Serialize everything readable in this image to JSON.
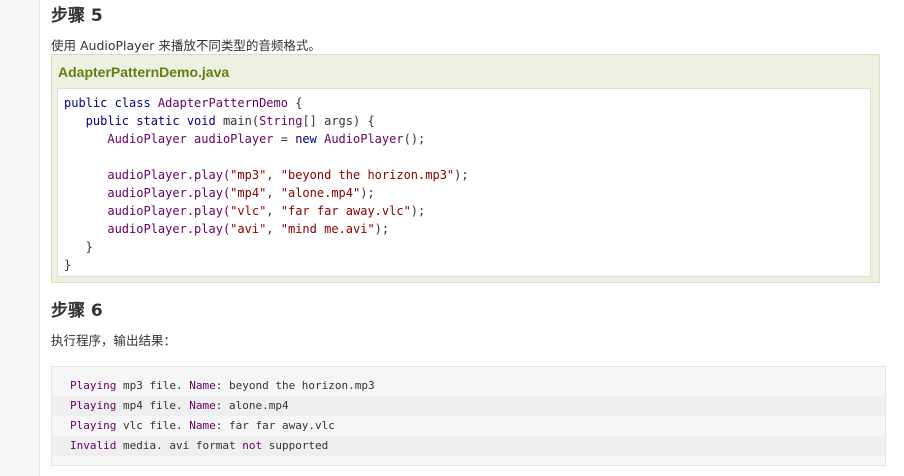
{
  "step5": {
    "title": "步骤 5",
    "description": "使用 AudioPlayer 来播放不同类型的音频格式。"
  },
  "example": {
    "filename": "AdapterPatternDemo.java",
    "code_lines": [
      [
        {
          "t": "public class ",
          "c": "kw"
        },
        {
          "t": "AdapterPatternDemo",
          "c": "typ"
        },
        {
          "t": " {",
          "c": "pln"
        }
      ],
      [
        {
          "t": "   public static void ",
          "c": "kw"
        },
        {
          "t": "main(",
          "c": "pln"
        },
        {
          "t": "String",
          "c": "typ"
        },
        {
          "t": "[] args) {",
          "c": "pln"
        }
      ],
      [
        {
          "t": "      AudioPlayer audioPlayer ",
          "c": "typ"
        },
        {
          "t": "= ",
          "c": "pln"
        },
        {
          "t": "new ",
          "c": "kw"
        },
        {
          "t": "AudioPlayer",
          "c": "typ"
        },
        {
          "t": "();",
          "c": "pln"
        }
      ],
      [
        {
          "t": "",
          "c": "pln"
        }
      ],
      [
        {
          "t": "      audioPlayer.play(",
          "c": "typ"
        },
        {
          "t": "\"mp3\"",
          "c": "str"
        },
        {
          "t": ", ",
          "c": "pln"
        },
        {
          "t": "\"beyond the horizon.mp3\"",
          "c": "str"
        },
        {
          "t": ");",
          "c": "pln"
        }
      ],
      [
        {
          "t": "      audioPlayer.play(",
          "c": "typ"
        },
        {
          "t": "\"mp4\"",
          "c": "str"
        },
        {
          "t": ", ",
          "c": "pln"
        },
        {
          "t": "\"alone.mp4\"",
          "c": "str"
        },
        {
          "t": ");",
          "c": "pln"
        }
      ],
      [
        {
          "t": "      audioPlayer.play(",
          "c": "typ"
        },
        {
          "t": "\"vlc\"",
          "c": "str"
        },
        {
          "t": ", ",
          "c": "pln"
        },
        {
          "t": "\"far far away.vlc\"",
          "c": "str"
        },
        {
          "t": ");",
          "c": "pln"
        }
      ],
      [
        {
          "t": "      audioPlayer.play(",
          "c": "typ"
        },
        {
          "t": "\"avi\"",
          "c": "str"
        },
        {
          "t": ", ",
          "c": "pln"
        },
        {
          "t": "\"mind me.avi\"",
          "c": "str"
        },
        {
          "t": ");",
          "c": "pln"
        }
      ],
      [
        {
          "t": "   }",
          "c": "pln"
        }
      ],
      [
        {
          "t": "}",
          "c": "pln"
        }
      ]
    ]
  },
  "step6": {
    "title": "步骤 6",
    "description": "执行程序，输出结果："
  },
  "output_lines": [
    [
      {
        "t": "Playing",
        "c": "typ"
      },
      {
        "t": " mp3 file. ",
        "c": "pln"
      },
      {
        "t": "Name",
        "c": "typ"
      },
      {
        "t": ": beyond the horizon.mp3",
        "c": "pln"
      }
    ],
    [
      {
        "t": "Playing",
        "c": "typ"
      },
      {
        "t": " mp4 file. ",
        "c": "pln"
      },
      {
        "t": "Name",
        "c": "typ"
      },
      {
        "t": ": alone.mp4",
        "c": "pln"
      }
    ],
    [
      {
        "t": "Playing",
        "c": "typ"
      },
      {
        "t": " vlc file. ",
        "c": "pln"
      },
      {
        "t": "Name",
        "c": "typ"
      },
      {
        "t": ": far far away.vlc",
        "c": "pln"
      }
    ],
    [
      {
        "t": "Invalid",
        "c": "typ"
      },
      {
        "t": " media. avi format ",
        "c": "pln"
      },
      {
        "t": "not",
        "c": "typ"
      },
      {
        "t": " supported",
        "c": "pln"
      }
    ]
  ]
}
